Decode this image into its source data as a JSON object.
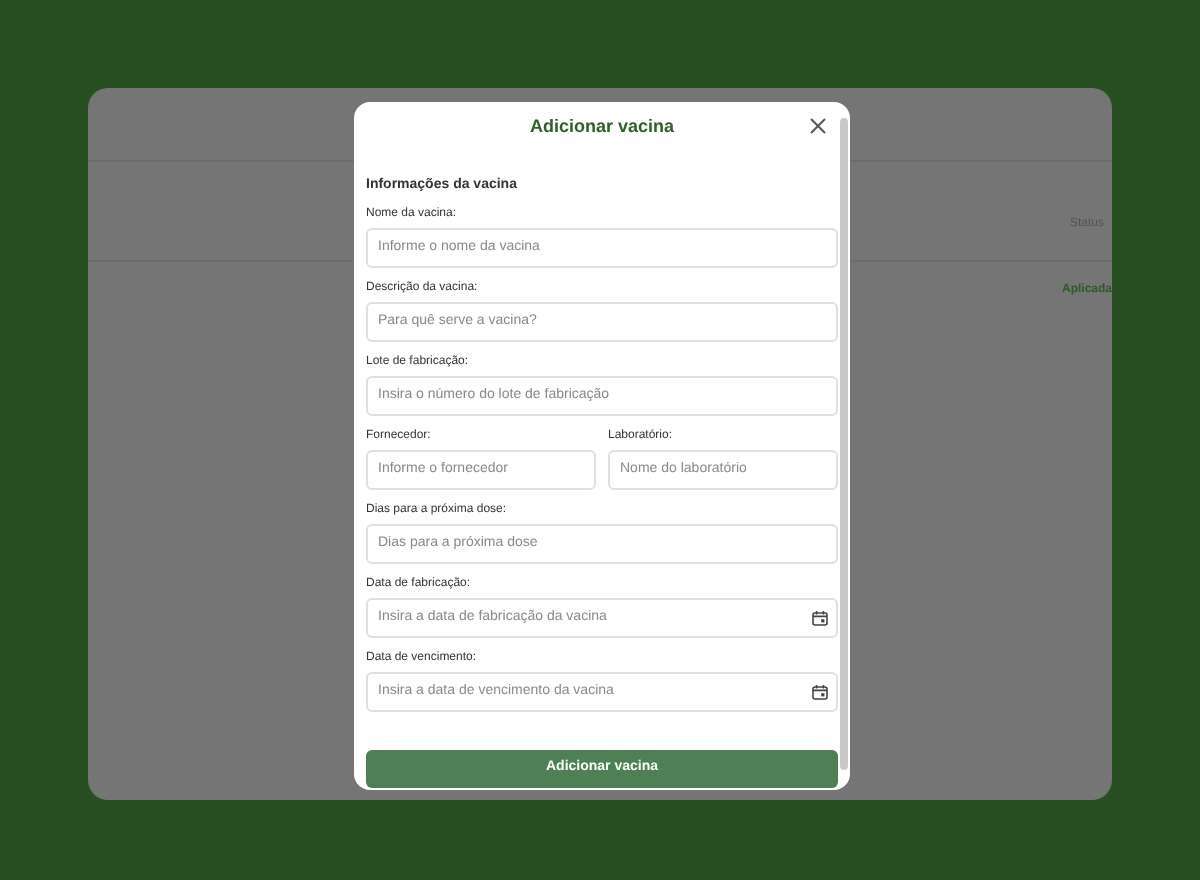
{
  "background": {
    "column_header": "Status",
    "status_cell": "Aplicada"
  },
  "modal": {
    "title": "Adicionar vacina",
    "section": "Informações da vacina",
    "rows": [
      [
        {
          "label": "Nome da vacina:",
          "placeholder": "Informe o nome da vacina",
          "kind": "text"
        }
      ],
      [
        {
          "label": "Descrição da vacina:",
          "placeholder": "Para quê serve a vacina?",
          "kind": "text"
        }
      ],
      [
        {
          "label": "Lote de fabricação:",
          "placeholder": "Insira o número do lote de fabricação",
          "kind": "text"
        }
      ],
      [
        {
          "label": "Fornecedor:",
          "placeholder": "Informe o fornecedor",
          "kind": "text"
        },
        {
          "label": "Laboratório:",
          "placeholder": "Nome do laboratório",
          "kind": "text"
        }
      ],
      [
        {
          "label": "Dias para a próxima dose:",
          "placeholder": "Dias para a próxima dose",
          "kind": "text"
        }
      ],
      [
        {
          "label": "Data de fabricação:",
          "placeholder": "Insira a data de fabricação da vacina",
          "kind": "date"
        }
      ],
      [
        {
          "label": "Data de vencimento:",
          "placeholder": "Insira a data de vencimento da vacina",
          "kind": "date"
        }
      ]
    ],
    "submit": "Adicionar vacina"
  }
}
